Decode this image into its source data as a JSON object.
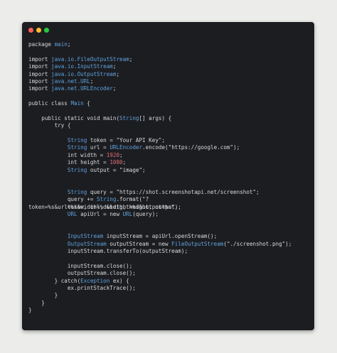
{
  "window": {
    "controls": [
      "close",
      "minimize",
      "maximize"
    ]
  },
  "colors": {
    "background": "#ecedea",
    "editor": "#1c1d21",
    "text": "#d7d9dc",
    "type": "#5ea3df",
    "number": "#e06c75"
  },
  "code": {
    "lines": [
      [
        {
          "t": "package ",
          "c": "kw"
        },
        {
          "t": "main",
          "c": "cls"
        },
        {
          "t": ";",
          "c": "plain"
        }
      ],
      [],
      [
        {
          "t": "import ",
          "c": "kw"
        },
        {
          "t": "java.io.FileOutputStream",
          "c": "cls"
        },
        {
          "t": ";",
          "c": "plain"
        }
      ],
      [
        {
          "t": "import ",
          "c": "kw"
        },
        {
          "t": "java.io.InputStream",
          "c": "cls"
        },
        {
          "t": ";",
          "c": "plain"
        }
      ],
      [
        {
          "t": "import ",
          "c": "kw"
        },
        {
          "t": "java.io.OutputStream",
          "c": "cls"
        },
        {
          "t": ";",
          "c": "plain"
        }
      ],
      [
        {
          "t": "import ",
          "c": "kw"
        },
        {
          "t": "java.net.URL",
          "c": "cls"
        },
        {
          "t": ";",
          "c": "plain"
        }
      ],
      [
        {
          "t": "import ",
          "c": "kw"
        },
        {
          "t": "java.net.URLEncoder",
          "c": "cls"
        },
        {
          "t": ";",
          "c": "plain"
        }
      ],
      [],
      [
        {
          "t": "public class ",
          "c": "kw"
        },
        {
          "t": "Main",
          "c": "cls"
        },
        {
          "t": " {",
          "c": "plain"
        }
      ],
      [],
      [
        {
          "t": "    public static void ",
          "c": "kw"
        },
        {
          "t": "main",
          "c": "plain"
        },
        {
          "t": "(",
          "c": "plain"
        },
        {
          "t": "String",
          "c": "cls"
        },
        {
          "t": "[] args) {",
          "c": "plain"
        }
      ],
      [
        {
          "t": "        try ",
          "c": "kw"
        },
        {
          "t": "{",
          "c": "plain"
        }
      ],
      [],
      [
        {
          "t": "            ",
          "c": "plain"
        },
        {
          "t": "String",
          "c": "cls"
        },
        {
          "t": " token = ",
          "c": "plain"
        },
        {
          "t": "\"Your API Key\"",
          "c": "str"
        },
        {
          "t": ";",
          "c": "plain"
        }
      ],
      [
        {
          "t": "            ",
          "c": "plain"
        },
        {
          "t": "String",
          "c": "cls"
        },
        {
          "t": " url = ",
          "c": "plain"
        },
        {
          "t": "URLEncoder",
          "c": "cls"
        },
        {
          "t": ".encode(",
          "c": "plain"
        },
        {
          "t": "\"https://google.com\"",
          "c": "str"
        },
        {
          "t": ");",
          "c": "plain"
        }
      ],
      [
        {
          "t": "            int ",
          "c": "kw"
        },
        {
          "t": "width = ",
          "c": "plain"
        },
        {
          "t": "1920",
          "c": "num"
        },
        {
          "t": ";",
          "c": "plain"
        }
      ],
      [
        {
          "t": "            int ",
          "c": "kw"
        },
        {
          "t": "height = ",
          "c": "plain"
        },
        {
          "t": "1080",
          "c": "num"
        },
        {
          "t": ";",
          "c": "plain"
        }
      ],
      [
        {
          "t": "            ",
          "c": "plain"
        },
        {
          "t": "String",
          "c": "cls"
        },
        {
          "t": " output = ",
          "c": "plain"
        },
        {
          "t": "\"image\"",
          "c": "str"
        },
        {
          "t": ";",
          "c": "plain"
        }
      ],
      [],
      [],
      [
        {
          "t": "            ",
          "c": "plain"
        },
        {
          "t": "String",
          "c": "cls"
        },
        {
          "t": " query = ",
          "c": "plain"
        },
        {
          "t": "\"https://shot.screenshotapi.net/screenshot\"",
          "c": "str"
        },
        {
          "t": ";",
          "c": "plain"
        }
      ],
      [
        {
          "t": "            query += ",
          "c": "plain"
        },
        {
          "t": "String",
          "c": "cls"
        },
        {
          "t": ".format(",
          "c": "plain"
        },
        {
          "t": "\"?",
          "c": "str"
        }
      ],
      [
        {
          "t": "token=%s&url=%s&width=%d&height=%d&output=%s\"",
          "c": "str"
        },
        {
          "t": ",",
          "c": "plain"
        }
      ],
      [
        {
          "t": "            ",
          "c": "plain"
        },
        {
          "t": "URL",
          "c": "cls"
        },
        {
          "t": " apiUrl = ",
          "c": "plain"
        },
        {
          "t": "new ",
          "c": "kw"
        },
        {
          "t": "URL",
          "c": "cls"
        },
        {
          "t": "(query);",
          "c": "plain"
        }
      ],
      [],
      [],
      [
        {
          "t": "            ",
          "c": "plain"
        },
        {
          "t": "InputStream",
          "c": "cls"
        },
        {
          "t": " inputStream = apiUrl.openStream();",
          "c": "plain"
        }
      ],
      [
        {
          "t": "            ",
          "c": "plain"
        },
        {
          "t": "OutputStream",
          "c": "cls"
        },
        {
          "t": " outputStream = ",
          "c": "plain"
        },
        {
          "t": "new ",
          "c": "kw"
        },
        {
          "t": "FileOutputStream",
          "c": "cls"
        },
        {
          "t": "(",
          "c": "plain"
        },
        {
          "t": "\"./screenshot.png\"",
          "c": "str"
        },
        {
          "t": ");",
          "c": "plain"
        }
      ],
      [
        {
          "t": "            inputStream.transferTo(outputStream);",
          "c": "plain"
        }
      ],
      [],
      [
        {
          "t": "            inputStream.close();",
          "c": "plain"
        }
      ],
      [
        {
          "t": "            outputStream.close();",
          "c": "plain"
        }
      ],
      [
        {
          "t": "        } ",
          "c": "plain"
        },
        {
          "t": "catch",
          "c": "kw"
        },
        {
          "t": "(",
          "c": "plain"
        },
        {
          "t": "Exception",
          "c": "cls"
        },
        {
          "t": " ex) {",
          "c": "plain"
        }
      ],
      [
        {
          "t": "            ex.printStackTrace();",
          "c": "plain"
        }
      ],
      [
        {
          "t": "        }",
          "c": "plain"
        }
      ],
      [
        {
          "t": "    }",
          "c": "plain"
        }
      ],
      [
        {
          "t": "}",
          "c": "plain"
        }
      ]
    ],
    "overlap_line_index": 22,
    "overlap_text": [
      {
        "t": "            token, url, width, height, output);",
        "c": "plain"
      }
    ]
  }
}
